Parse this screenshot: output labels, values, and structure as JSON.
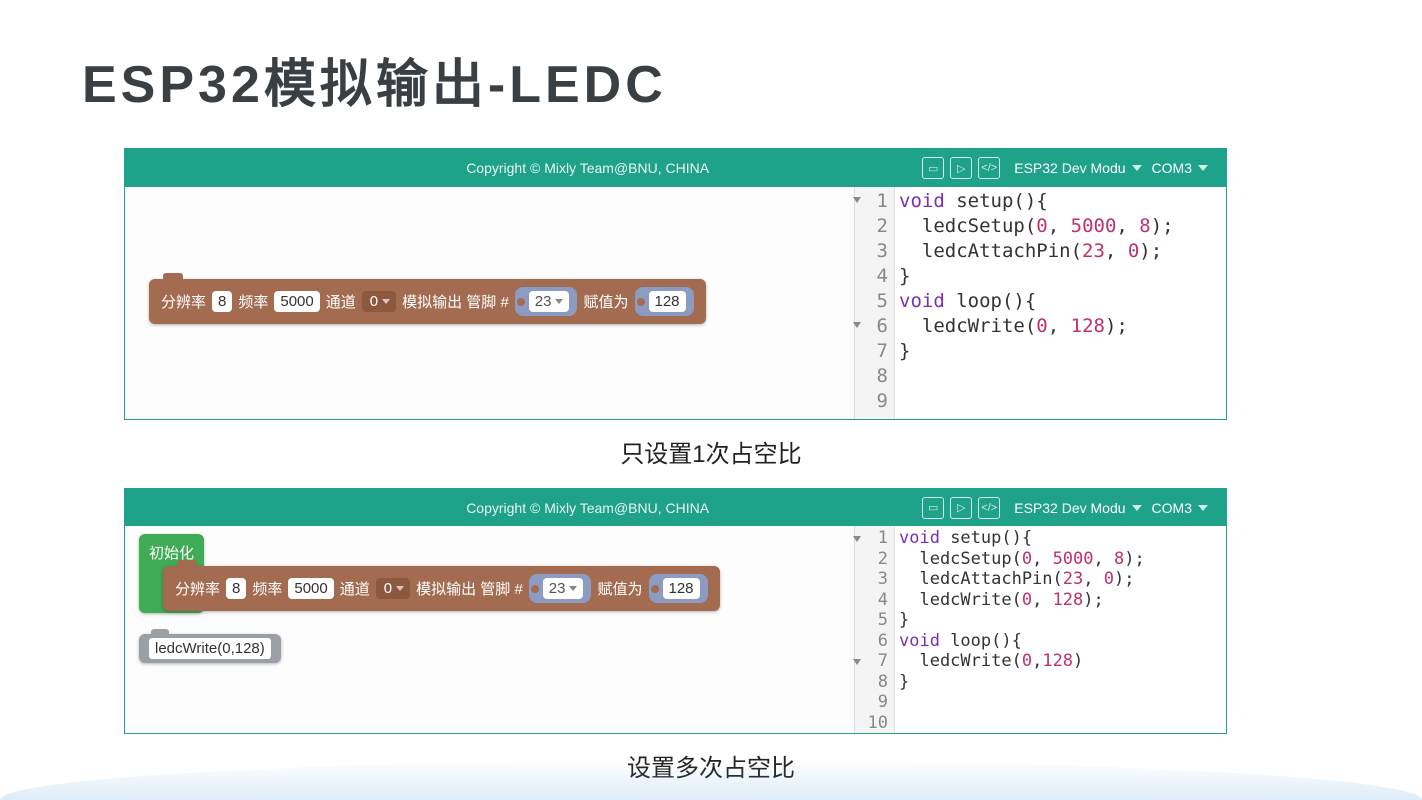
{
  "page_title": "ESP32模拟输出-LEDC",
  "caption_1": "只设置1次占空比",
  "caption_2": "设置多次占空比",
  "toolbar": {
    "copyright": "Copyright © Mixly Team@BNU, CHINA",
    "board": "ESP32 Dev Modu",
    "port": "COM3"
  },
  "block": {
    "resolution_label": "分辨率",
    "resolution_value": "8",
    "freq_label": "频率",
    "freq_value": "5000",
    "channel_label": "通道",
    "channel_value": "0",
    "analog_out_label": "模拟输出 管脚 #",
    "pin_value": "23",
    "assign_label": "赋值为",
    "assign_value": "128",
    "init_label": "初始化",
    "grey_call": "ledcWrite(0,128)"
  },
  "code1": {
    "lines": [
      {
        "n": "1",
        "t": [
          {
            "c": "kw",
            "v": "void"
          },
          {
            "c": "",
            "v": " setup(){"
          }
        ],
        "fold": true
      },
      {
        "n": "2",
        "t": [
          {
            "c": "",
            "v": "  ledcSetup("
          },
          {
            "c": "num",
            "v": "0"
          },
          {
            "c": "",
            "v": ", "
          },
          {
            "c": "num",
            "v": "5000"
          },
          {
            "c": "",
            "v": ", "
          },
          {
            "c": "num",
            "v": "8"
          },
          {
            "c": "",
            "v": ");"
          }
        ]
      },
      {
        "n": "3",
        "t": [
          {
            "c": "",
            "v": "  ledcAttachPin("
          },
          {
            "c": "num",
            "v": "23"
          },
          {
            "c": "",
            "v": ", "
          },
          {
            "c": "num",
            "v": "0"
          },
          {
            "c": "",
            "v": ");"
          }
        ]
      },
      {
        "n": "4",
        "t": [
          {
            "c": "",
            "v": "}"
          }
        ]
      },
      {
        "n": "5",
        "t": [
          {
            "c": "",
            "v": ""
          }
        ]
      },
      {
        "n": "6",
        "t": [
          {
            "c": "kw",
            "v": "void"
          },
          {
            "c": "",
            "v": " loop(){"
          }
        ],
        "fold": true
      },
      {
        "n": "7",
        "t": [
          {
            "c": "",
            "v": "  ledcWrite("
          },
          {
            "c": "num",
            "v": "0"
          },
          {
            "c": "",
            "v": ", "
          },
          {
            "c": "num",
            "v": "128"
          },
          {
            "c": "",
            "v": ");"
          }
        ]
      },
      {
        "n": "8",
        "t": [
          {
            "c": "",
            "v": ""
          }
        ]
      },
      {
        "n": "9",
        "t": [
          {
            "c": "",
            "v": "}"
          }
        ]
      }
    ]
  },
  "code2": {
    "lines": [
      {
        "n": "1",
        "t": [
          {
            "c": "kw",
            "v": "void"
          },
          {
            "c": "",
            "v": " setup(){"
          }
        ],
        "fold": true
      },
      {
        "n": "2",
        "t": [
          {
            "c": "",
            "v": "  ledcSetup("
          },
          {
            "c": "num",
            "v": "0"
          },
          {
            "c": "",
            "v": ", "
          },
          {
            "c": "num",
            "v": "5000"
          },
          {
            "c": "",
            "v": ", "
          },
          {
            "c": "num",
            "v": "8"
          },
          {
            "c": "",
            "v": ");"
          }
        ]
      },
      {
        "n": "3",
        "t": [
          {
            "c": "",
            "v": "  ledcAttachPin("
          },
          {
            "c": "num",
            "v": "23"
          },
          {
            "c": "",
            "v": ", "
          },
          {
            "c": "num",
            "v": "0"
          },
          {
            "c": "",
            "v": ");"
          }
        ]
      },
      {
        "n": "4",
        "t": [
          {
            "c": "",
            "v": "  ledcWrite("
          },
          {
            "c": "num",
            "v": "0"
          },
          {
            "c": "",
            "v": ", "
          },
          {
            "c": "num",
            "v": "128"
          },
          {
            "c": "",
            "v": ");"
          }
        ]
      },
      {
        "n": "5",
        "t": [
          {
            "c": "",
            "v": "}"
          }
        ]
      },
      {
        "n": "6",
        "t": [
          {
            "c": "",
            "v": ""
          }
        ]
      },
      {
        "n": "7",
        "t": [
          {
            "c": "kw",
            "v": "void"
          },
          {
            "c": "",
            "v": " loop(){"
          }
        ],
        "fold": true
      },
      {
        "n": "8",
        "t": [
          {
            "c": "",
            "v": "  ledcWrite("
          },
          {
            "c": "num",
            "v": "0"
          },
          {
            "c": "",
            "v": ","
          },
          {
            "c": "num",
            "v": "128"
          },
          {
            "c": "",
            "v": ")"
          }
        ]
      },
      {
        "n": "9",
        "t": [
          {
            "c": "",
            "v": ""
          }
        ],
        "hl": true
      },
      {
        "n": "10",
        "t": [
          {
            "c": "",
            "v": "}"
          }
        ]
      }
    ]
  }
}
